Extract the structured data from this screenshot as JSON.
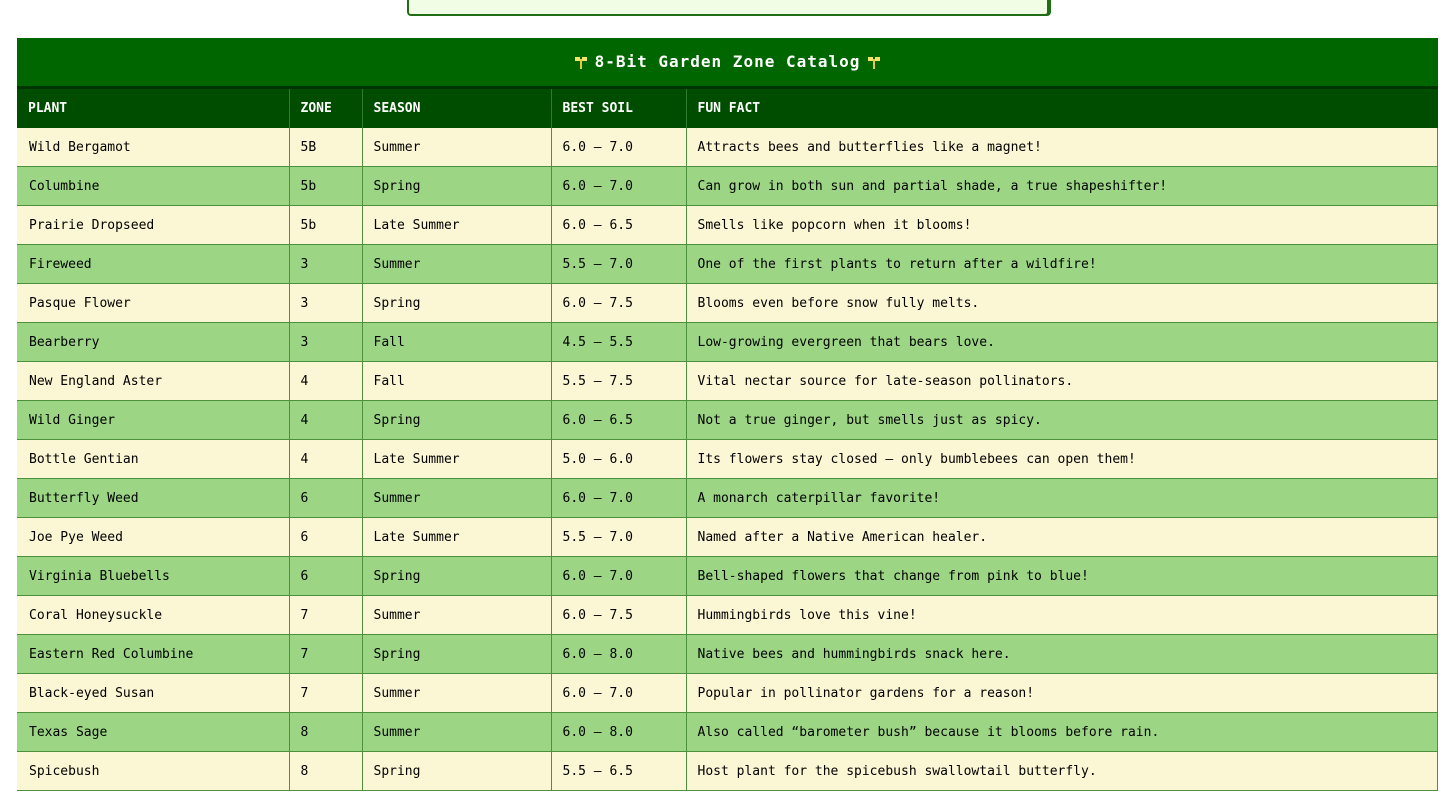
{
  "catalog": {
    "title": "8-Bit Garden Zone Catalog",
    "columns": [
      "PLANT",
      "ZONE",
      "SEASON",
      "BEST SOIL",
      "FUN FACT"
    ],
    "rows": [
      [
        "Wild Bergamot",
        "5B",
        "Summer",
        "6.0 – 7.0",
        "Attracts bees and butterflies like a magnet!"
      ],
      [
        "Columbine",
        "5b",
        "Spring",
        "6.0 – 7.0",
        "Can grow in both sun and partial shade, a true shapeshifter!"
      ],
      [
        "Prairie Dropseed",
        "5b",
        "Late Summer",
        "6.0 – 6.5",
        "Smells like popcorn when it blooms!"
      ],
      [
        "Fireweed",
        "3",
        "Summer",
        "5.5 – 7.0",
        "One of the first plants to return after a wildfire!"
      ],
      [
        "Pasque Flower",
        "3",
        "Spring",
        "6.0 – 7.5",
        "Blooms even before snow fully melts."
      ],
      [
        "Bearberry",
        "3",
        "Fall",
        "4.5 – 5.5",
        "Low-growing evergreen that bears love."
      ],
      [
        "New England Aster",
        "4",
        "Fall",
        "5.5 – 7.5",
        "Vital nectar source for late-season pollinators."
      ],
      [
        "Wild Ginger",
        "4",
        "Spring",
        "6.0 – 6.5",
        "Not a true ginger, but smells just as spicy."
      ],
      [
        "Bottle Gentian",
        "4",
        "Late Summer",
        "5.0 – 6.0",
        "Its flowers stay closed – only bumblebees can open them!"
      ],
      [
        "Butterfly Weed",
        "6",
        "Summer",
        "6.0 – 7.0",
        "A monarch caterpillar favorite!"
      ],
      [
        "Joe Pye Weed",
        "6",
        "Late Summer",
        "5.5 – 7.0",
        "Named after a Native American healer."
      ],
      [
        "Virginia Bluebells",
        "6",
        "Spring",
        "6.0 – 7.0",
        "Bell-shaped flowers that change from pink to blue!"
      ],
      [
        "Coral Honeysuckle",
        "7",
        "Summer",
        "6.0 – 7.5",
        "Hummingbirds love this vine!"
      ],
      [
        "Eastern Red Columbine",
        "7",
        "Spring",
        "6.0 – 8.0",
        "Native bees and hummingbirds snack here."
      ],
      [
        "Black-eyed Susan",
        "7",
        "Summer",
        "6.0 – 7.0",
        "Popular in pollinator gardens for a reason!"
      ],
      [
        "Texas Sage",
        "8",
        "Summer",
        "6.0 – 8.0",
        "Also called “barometer bush” because it blooms before rain."
      ],
      [
        "Spicebush",
        "8",
        "Spring",
        "5.5 – 6.5",
        "Host plant for the spicebush swallowtail butterfly."
      ]
    ]
  },
  "colors": {
    "title_bar": "#006600",
    "header_row": "#004d00",
    "row_light": "#fbf6d3",
    "row_green": "#9cd684",
    "top_box": "#f1fde4"
  },
  "icons": {
    "title_decoration": "sprout-icon"
  }
}
